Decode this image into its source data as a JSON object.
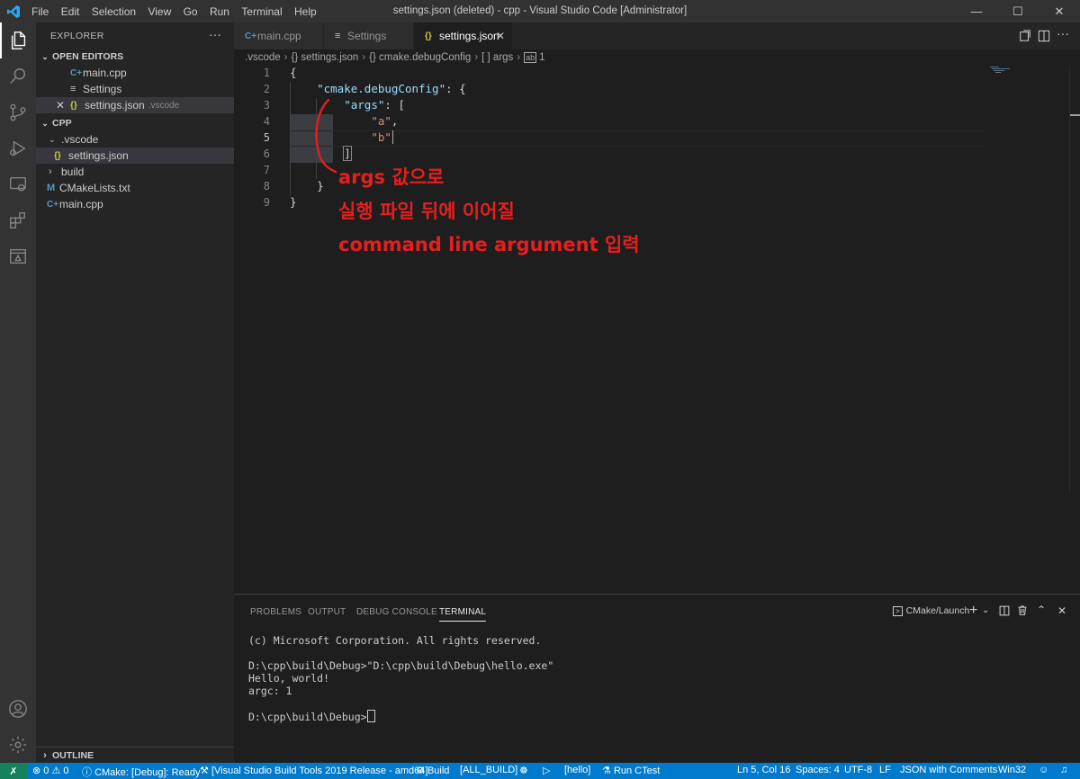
{
  "window": {
    "title": "settings.json (deleted) - cpp - Visual Studio Code [Administrator]",
    "menu": [
      "File",
      "Edit",
      "Selection",
      "View",
      "Go",
      "Run",
      "Terminal",
      "Help"
    ]
  },
  "sidebar": {
    "title": "EXPLORER",
    "more": "···",
    "open_editors_label": "OPEN EDITORS",
    "open_editors": [
      {
        "label": "main.cpp",
        "icon": "cpp-file-icon"
      },
      {
        "label": "Settings",
        "icon": "settings-file-icon"
      },
      {
        "label": "settings.json",
        "hint": ".vscode",
        "icon": "json-file-icon"
      }
    ],
    "folder_label": "CPP",
    "tree": [
      {
        "label": ".vscode",
        "type": "folder-open"
      },
      {
        "label": "settings.json",
        "type": "json"
      },
      {
        "label": "build",
        "type": "folder-closed"
      },
      {
        "label": "CMakeLists.txt",
        "type": "cmake"
      },
      {
        "label": "main.cpp",
        "type": "cpp"
      }
    ],
    "outline_label": "OUTLINE"
  },
  "tabs": [
    {
      "label": "main.cpp",
      "icon": "cpp-file-icon"
    },
    {
      "label": "Settings",
      "icon": "settings-file-icon"
    },
    {
      "label": "settings.json",
      "icon": "json-file-icon",
      "active": true
    }
  ],
  "breadcrumb": [
    ".vscode",
    "{} settings.json",
    "{} cmake.debugConfig",
    "[ ] args",
    "1"
  ],
  "editor": {
    "line_numbers": [
      "1",
      "2",
      "3",
      "4",
      "5",
      "6",
      "7",
      "8",
      "9"
    ],
    "current_line": "5",
    "code": {
      "l1": "{",
      "l2_key": "\"cmake.debugConfig\"",
      "l2_rest": ": {",
      "l3_key": "\"args\"",
      "l3_rest": ": [",
      "l4_val": "\"a\"",
      "l4_rest": ",",
      "l5_val": "\"b\"",
      "l6": "]",
      "l8": "}",
      "l9": "}"
    },
    "annotation": {
      "line1": "args 값으로",
      "line2": "실행 파일 뒤에 이어질",
      "line3": "command line argument 입력",
      "color": "#e51f1f"
    }
  },
  "panel": {
    "tabs": [
      "PROBLEMS",
      "OUTPUT",
      "DEBUG CONSOLE",
      "TERMINAL"
    ],
    "active_tab": "TERMINAL",
    "terminal_selector": "CMake/Launch",
    "terminal_lines": [
      "(c) Microsoft Corporation. All rights reserved.",
      "",
      "D:\\cpp\\build\\Debug>\"D:\\cpp\\build\\Debug\\hello.exe\"",
      "Hello, world!",
      "argc: 1",
      "",
      "D:\\cpp\\build\\Debug>"
    ]
  },
  "statusbar": {
    "errors": "0",
    "warnings": "0",
    "cmake_status": "CMake: [Debug]: Ready",
    "kit": "[Visual Studio Build Tools 2019 Release - amd64]",
    "build": "Build",
    "target": "[ALL_BUILD]",
    "launch_target": "[hello]",
    "run_ctest": "Run CTest",
    "position": "Ln 5, Col 16",
    "spaces": "Spaces: 4",
    "encoding": "UTF-8",
    "eol": "LF",
    "language": "JSON with Comments",
    "platform": "Win32"
  },
  "colors": {
    "accent": "#007acc",
    "remote": "#16825d",
    "annotation": "#e51f1f"
  }
}
